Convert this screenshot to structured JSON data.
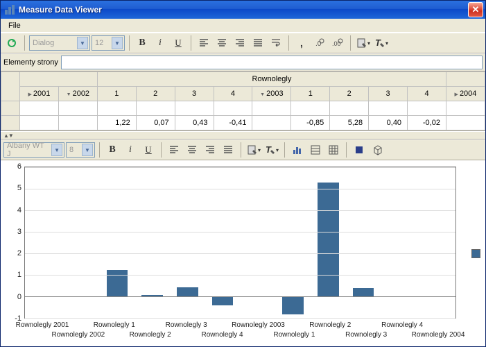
{
  "window": {
    "title": "Measure Data Viewer"
  },
  "menu": {
    "file": "File"
  },
  "toolbar1": {
    "font_name": "Dialog",
    "font_size": "12"
  },
  "strip": {
    "label": "Elementy strony",
    "value": ""
  },
  "table": {
    "group_header": "Rownolegly",
    "cols": [
      "2001",
      "2002",
      "1",
      "2",
      "3",
      "4",
      "2003",
      "1",
      "2",
      "3",
      "4",
      "2004"
    ],
    "expand_flags": [
      true,
      false,
      null,
      null,
      null,
      null,
      false,
      null,
      null,
      null,
      null,
      true
    ],
    "values": [
      "",
      "",
      "1,22",
      "0,07",
      "0,43",
      "-0,41",
      "",
      "-0,85",
      "5,28",
      "0,40",
      "-0,02",
      ""
    ]
  },
  "toolbar2": {
    "font_name": "Albany WT J",
    "font_size": "8"
  },
  "chart_data": {
    "type": "bar",
    "categories": [
      "Rownolegly 2001",
      "Rownolegly 2002",
      "Rownolegly 1",
      "Rownolegly 2",
      "Rownolegly 3",
      "Rownolegly 4",
      "Rownolegly 2003",
      "Rownolegly 1",
      "Rownolegly 2",
      "Rownolegly 3",
      "Rownolegly 4",
      "Rownolegly 2004"
    ],
    "values": [
      0,
      0,
      1.22,
      0.07,
      0.43,
      -0.41,
      0,
      -0.85,
      5.28,
      0.4,
      -0.02,
      0
    ],
    "ylim": [
      -1,
      6
    ],
    "yticks": [
      -1,
      0,
      1,
      2,
      3,
      4,
      5,
      6
    ],
    "series_color": "#3c6a94"
  }
}
